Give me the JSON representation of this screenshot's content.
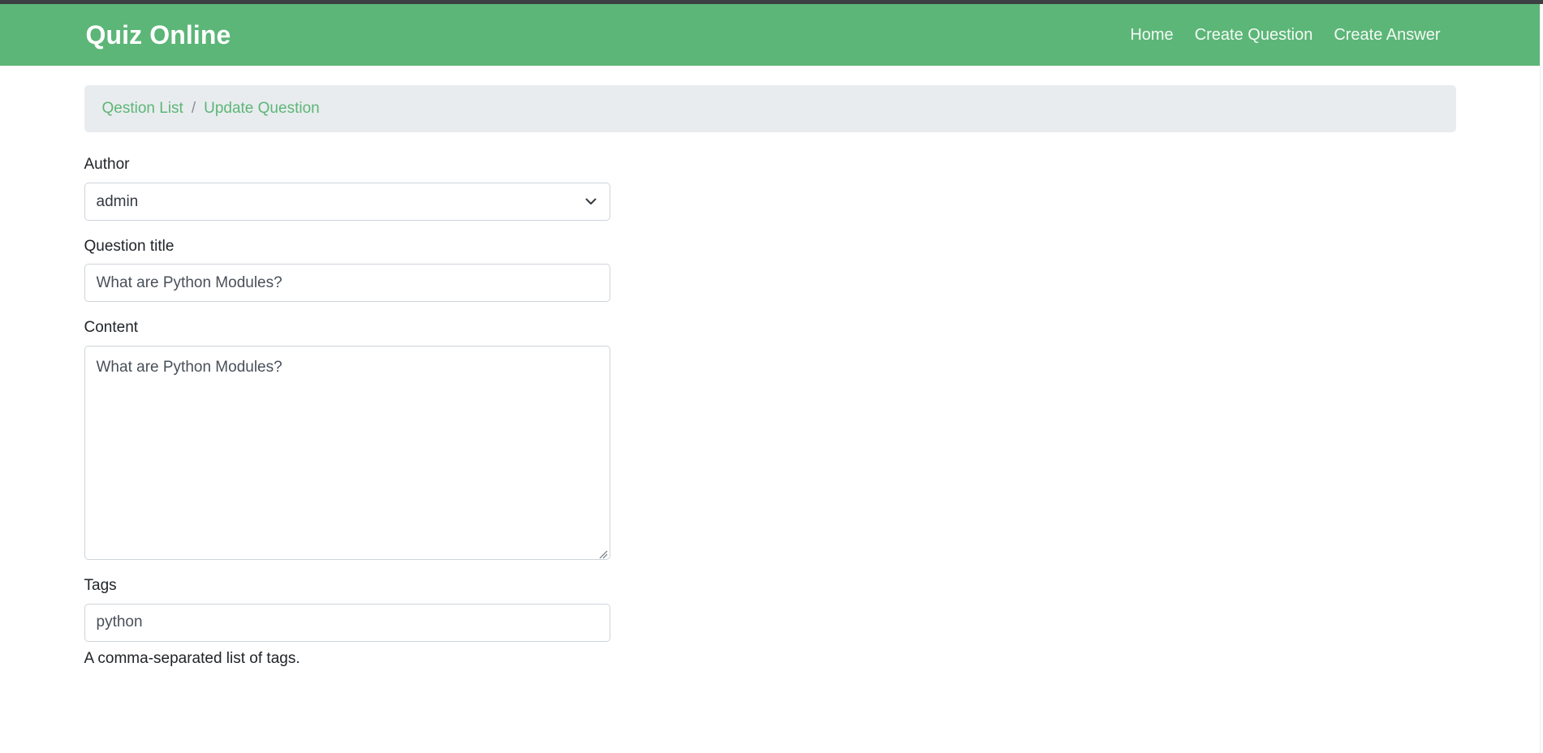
{
  "navbar": {
    "brand": "Quiz Online",
    "links": [
      {
        "label": "Home"
      },
      {
        "label": "Create Question"
      },
      {
        "label": "Create Answer"
      }
    ],
    "background_color": "#5cb677"
  },
  "breadcrumb": {
    "items": [
      {
        "label": "Qestion List"
      },
      {
        "label": "Update Question"
      }
    ],
    "separator": "/",
    "link_color": "#5cb677",
    "background_color": "#e9ecef"
  },
  "form": {
    "author": {
      "label": "Author",
      "value": "admin",
      "options": [
        "admin"
      ],
      "chevron_icon": "chevron-down-icon"
    },
    "question_title": {
      "label": "Question title",
      "value": "What are Python Modules?",
      "placeholder": ""
    },
    "content": {
      "label": "Content",
      "value": "What are Python Modules?",
      "placeholder": ""
    },
    "tags": {
      "label": "Tags",
      "value": "python",
      "placeholder": "",
      "help_text": "A comma-separated list of tags."
    }
  }
}
